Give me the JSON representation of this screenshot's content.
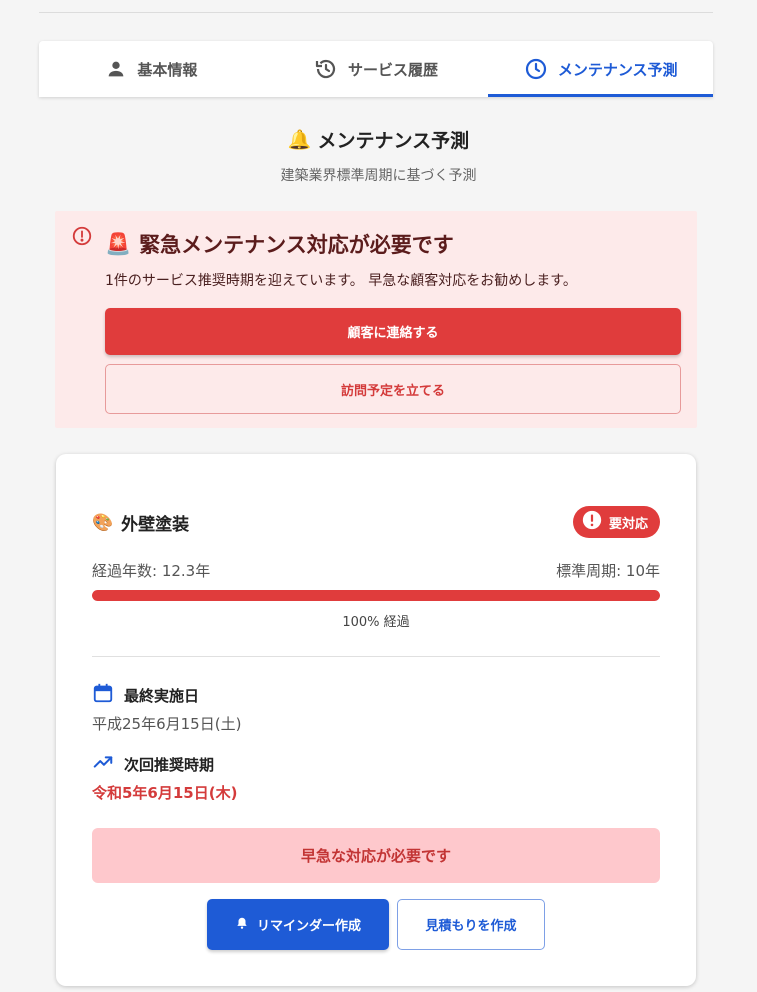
{
  "tabs": [
    {
      "label": "基本情報",
      "icon": "person-icon",
      "active": false
    },
    {
      "label": "サービス履歴",
      "icon": "history-icon",
      "active": false
    },
    {
      "label": "メンテナンス予測",
      "icon": "clock-icon",
      "active": true
    }
  ],
  "section": {
    "icon": "🔔",
    "title": "メンテナンス予測",
    "subtitle": "建築業界標準周期に基づく予測"
  },
  "alert": {
    "icon": "🚨",
    "title": "緊急メンテナンス対応が必要です",
    "message": "1件のサービス推奨時期を迎えています。 早急な顧客対応をお勧めします。",
    "contact_button": "顧客に連絡する",
    "visit_button": "訪問予定を立てる"
  },
  "item": {
    "icon": "🎨",
    "name": "外壁塗装",
    "badge": "要対応",
    "elapsed": "経過年数: 12.3年",
    "cycle": "標準周期: 10年",
    "progress_percent": 100,
    "progress_label": "100% 経過",
    "last_label": "最終実施日",
    "last_value": "平成25年6月15日(土)",
    "next_label": "次回推奨時期",
    "next_value": "令和5年6月15日(木)",
    "urgent_text": "早急な対応が必要です",
    "reminder_button": "リマインダー作成",
    "estimate_button": "見積もりを作成"
  },
  "colors": {
    "accent": "#1e5bd6",
    "danger": "#e03c3c",
    "alert_bg": "#fdeaea",
    "urgent_bg": "#fec8cc"
  }
}
